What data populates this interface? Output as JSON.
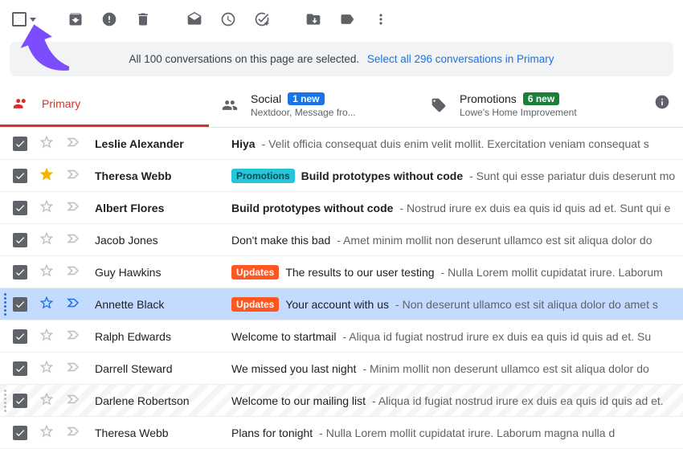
{
  "banner": {
    "text": "All 100 conversations on this page are selected.",
    "link": "Select all 296 conversations in Primary"
  },
  "tabs": {
    "primary": {
      "label": "Primary"
    },
    "social": {
      "label": "Social",
      "badge": "1 new",
      "sub": "Nextdoor, Message fro..."
    },
    "promotions": {
      "label": "Promotions",
      "badge": "6 new",
      "sub": "Lowe's Home Improvement"
    }
  },
  "rows": [
    {
      "sender": "Leslie Alexander",
      "sender_bold": true,
      "starred": false,
      "selected_bg": false,
      "hatched": false,
      "tag": null,
      "subject": "Hiya",
      "subject_bold": true,
      "snippet": "Velit officia consequat duis enim velit mollit. Exercitation veniam consequat s"
    },
    {
      "sender": "Theresa Webb",
      "sender_bold": true,
      "starred": true,
      "selected_bg": false,
      "hatched": false,
      "tag": "Promotions",
      "tag_class": "promotions",
      "subject": "Build prototypes without code",
      "subject_bold": true,
      "snippet": "Sunt qui esse pariatur duis deserunt mo"
    },
    {
      "sender": "Albert Flores",
      "sender_bold": true,
      "starred": false,
      "selected_bg": false,
      "hatched": false,
      "tag": null,
      "subject": "Build prototypes without code",
      "subject_bold": true,
      "snippet": "Nostrud irure ex duis ea quis id quis ad et. Sunt qui e"
    },
    {
      "sender": "Jacob Jones",
      "sender_bold": false,
      "starred": false,
      "selected_bg": false,
      "hatched": false,
      "tag": null,
      "subject": "Don't make this bad",
      "subject_bold": false,
      "snippet": "Amet minim mollit non deserunt ullamco est sit aliqua dolor do"
    },
    {
      "sender": "Guy Hawkins",
      "sender_bold": false,
      "starred": false,
      "selected_bg": false,
      "hatched": false,
      "tag": "Updates",
      "tag_class": "updates",
      "subject": "The results to our user testing",
      "subject_bold": false,
      "snippet": "Nulla Lorem mollit cupidatat irure. Laborum"
    },
    {
      "sender": "Annette Black",
      "sender_bold": false,
      "starred": false,
      "selected_bg": true,
      "hatched": false,
      "tag": "Updates",
      "tag_class": "updates",
      "subject": "Your account with us",
      "subject_bold": false,
      "snippet": "Non deserunt ullamco est sit aliqua dolor do amet s"
    },
    {
      "sender": "Ralph Edwards",
      "sender_bold": false,
      "starred": false,
      "selected_bg": false,
      "hatched": false,
      "tag": null,
      "subject": "Welcome to startmail",
      "subject_bold": false,
      "snippet": "Aliqua id fugiat nostrud irure ex duis ea quis id quis ad et. Su"
    },
    {
      "sender": "Darrell Steward",
      "sender_bold": false,
      "starred": false,
      "selected_bg": false,
      "hatched": false,
      "tag": null,
      "subject": "We missed you last night",
      "subject_bold": false,
      "snippet": "Minim mollit non deserunt ullamco est sit aliqua dolor do"
    },
    {
      "sender": "Darlene Robertson",
      "sender_bold": false,
      "starred": false,
      "selected_bg": false,
      "hatched": true,
      "tag": null,
      "subject": "Welcome to our mailing list",
      "subject_bold": false,
      "snippet": "Aliqua id fugiat nostrud irure ex duis ea quis id quis ad et."
    },
    {
      "sender": "Theresa Webb",
      "sender_bold": false,
      "starred": false,
      "selected_bg": false,
      "hatched": false,
      "tag": null,
      "subject": "Plans for tonight",
      "subject_bold": false,
      "snippet": "Nulla Lorem mollit cupidatat irure. Laborum magna nulla d"
    }
  ]
}
